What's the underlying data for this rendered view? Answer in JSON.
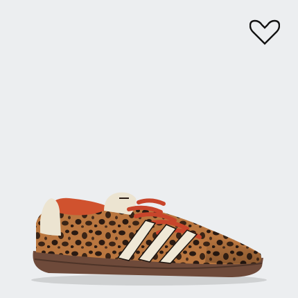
{
  "product": {
    "image_description": "",
    "wishlist_icon": "heart-outline-icon",
    "colors": {
      "background": "#eceef0",
      "gum_sole": "#6e4a3a",
      "leopard_base": "#b9763f",
      "leopard_spot": "#2a1a12",
      "stripe_cream": "#efe8d6",
      "lace_orange": "#c8452b",
      "lining_orange": "#d0522e",
      "heel_cream": "#ece4d1"
    }
  }
}
